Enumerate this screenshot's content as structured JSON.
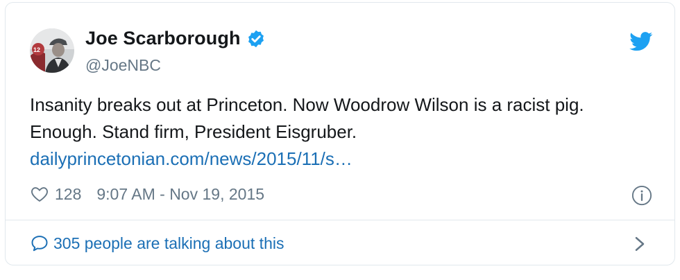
{
  "tweet": {
    "author": {
      "display_name": "Joe Scarborough",
      "handle": "@JoeNBC",
      "verified": true
    },
    "text_lines": [
      "Insanity breaks out at Princeton. Now Woodrow Wilson is a racist pig.",
      "Enough. Stand firm, President Eisgruber."
    ],
    "link_text": "dailyprincetonian.com/news/2015/11/s…",
    "like_count": "128",
    "timestamp": "9:07 AM - Nov 19, 2015",
    "talking_about": "305 people are talking about this"
  },
  "icons": {
    "brand": "twitter-bird-icon",
    "verified": "verified-badge-icon",
    "like": "heart-icon",
    "info": "info-icon",
    "reply": "speech-bubble-icon",
    "more": "chevron-right-icon"
  },
  "colors": {
    "twitter_blue": "#1da1f2",
    "link_blue": "#1b6fb5",
    "text": "#14171a",
    "muted": "#657786",
    "border": "#e1e8ed"
  }
}
